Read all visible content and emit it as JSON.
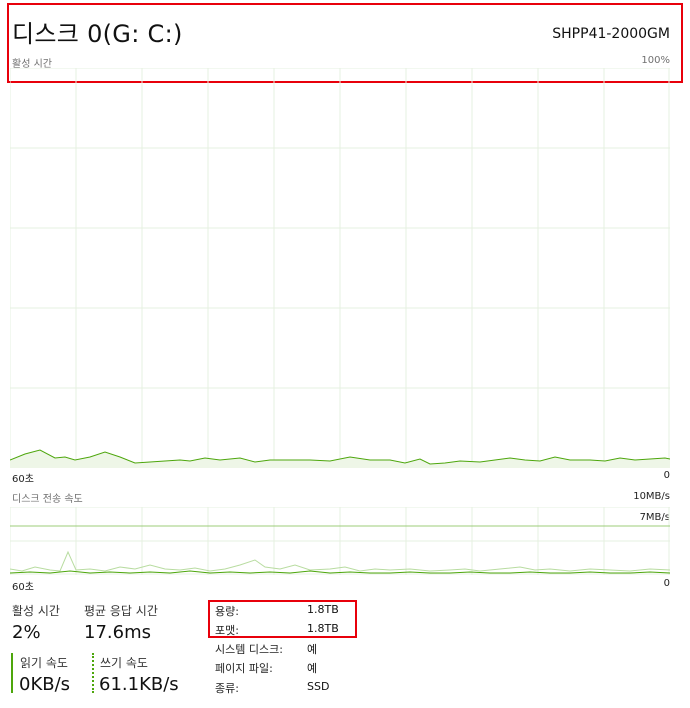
{
  "header": {
    "title": "디스크 0(G: C:)",
    "model": "SHPP41-2000GM",
    "activity_label": "활성 시간",
    "activity_max": "100%"
  },
  "activity_chart": {
    "left_label": "60초",
    "right_label": "0"
  },
  "transfer_chart": {
    "title": "디스크 전송 속도",
    "max_label": "10MB/s",
    "line_label": "7MB/s",
    "left_label": "60초",
    "right_label": "0"
  },
  "stats": {
    "active_time_label": "활성 시간",
    "active_time_value": "2%",
    "avg_response_label": "평균 응답 시간",
    "avg_response_value": "17.6ms",
    "read_label": "읽기 속도",
    "read_value": "0KB/s",
    "write_label": "쓰기 속도",
    "write_value": "61.1KB/s"
  },
  "properties": [
    {
      "label": "용량:",
      "value": "1.8TB"
    },
    {
      "label": "포맷:",
      "value": "1.8TB"
    },
    {
      "label": "시스템 디스크:",
      "value": "예"
    },
    {
      "label": "페이지 파일:",
      "value": "예"
    },
    {
      "label": "종류:",
      "value": "SSD"
    }
  ],
  "colors": {
    "accent": "#4da60c",
    "grid": "#e6f0e0",
    "highlight": "#e8000b"
  }
}
